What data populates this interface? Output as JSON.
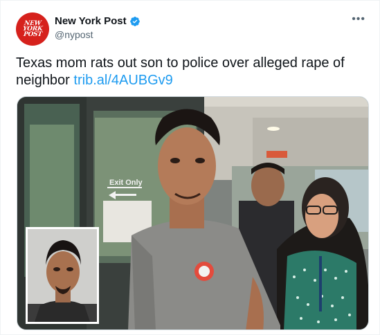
{
  "account": {
    "avatar_logo_lines": [
      "NEW",
      "YORK",
      "POST"
    ],
    "name": "New York Post",
    "handle": "@nypost",
    "verified_icon": "verified-badge-icon",
    "verified_color": "#1d9bf0"
  },
  "menu": {
    "more_label": "•••"
  },
  "tweet": {
    "text": "Texas mom rats out son to police over alleged rape of neighbor ",
    "link": "trib.al/4AUBGv9",
    "link_color": "#1d9bf0"
  },
  "media": {
    "photo_alt": "Man in gray t-shirt escorted by officers outside a building",
    "inset_alt": "Mugshot inset",
    "sign_text": "Exit Only"
  }
}
